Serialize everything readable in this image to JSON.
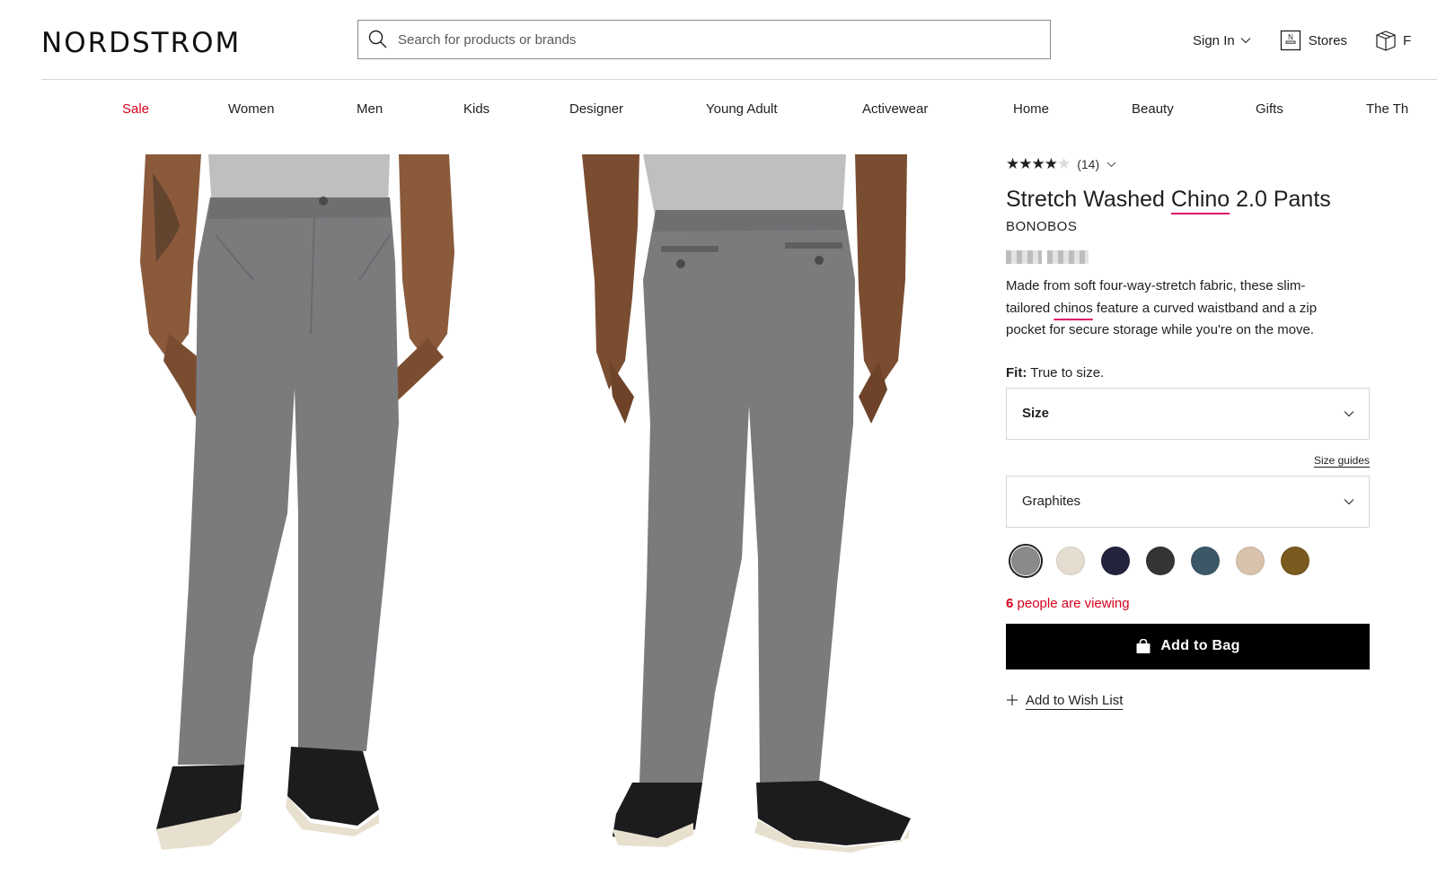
{
  "header": {
    "logo": "NORDSTROM",
    "search_placeholder": "Search for products or brands",
    "sign_in": "Sign In",
    "stores": "Stores",
    "store_icon_letter": "N",
    "cut_link": "F"
  },
  "nav": [
    "Sale",
    "Women",
    "Men",
    "Kids",
    "Designer",
    "Young Adult",
    "Activewear",
    "Home",
    "Beauty",
    "Gifts",
    "The Th"
  ],
  "product": {
    "rating_stars": 4,
    "rating_max": 5,
    "review_count": "(14)",
    "title_before": "Stretch Washed ",
    "title_highlight": "Chino",
    "title_after": " 2.0 Pants",
    "brand": "BONOBOS",
    "desc_before": "Made from soft four-way-stretch fabric, these slim-tailored ",
    "desc_highlight": "chinos",
    "desc_after": " feature a curved waistband and a zip pocket for secure storage while you're on the move.",
    "fit_label": "Fit:",
    "fit_value": "True to size.",
    "size_label": "Size",
    "size_guides": "Size guides",
    "color_label": "Graphites",
    "swatches": [
      "#8a898b",
      "#e4ddd0",
      "#23233d",
      "#353336",
      "#3c5768",
      "#d8c2ac",
      "#7a5a1f"
    ],
    "viewing_count": "6",
    "viewing_text": "people are viewing",
    "add_to_bag": "Add to Bag",
    "add_to_wishlist": "Add to Wish List"
  },
  "colors": {
    "sale_red": "#d6001c",
    "accent_pink": "#e0116a",
    "pants_gray": "#7b7b7e",
    "button_black": "#000000"
  }
}
